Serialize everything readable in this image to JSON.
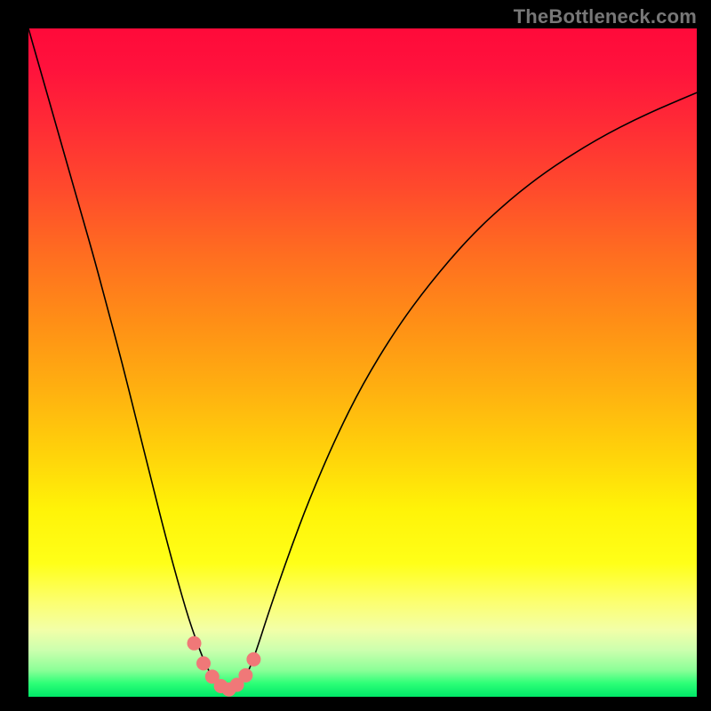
{
  "brand": {
    "watermark": "TheBottleneck.com"
  },
  "palette": {
    "frame": "#000000",
    "gradient_top": "#ff0a3a",
    "gradient_bottom": "#00e768",
    "curve": "#000000",
    "dot": "#f07878",
    "watermark": "#777777"
  },
  "chart_data": {
    "type": "line",
    "title": "",
    "xlabel": "",
    "ylabel": "",
    "xlim": [
      0,
      100
    ],
    "ylim": [
      0,
      100
    ],
    "grid": false,
    "legend": false,
    "annotations": [],
    "x": [
      0,
      2,
      4,
      6,
      8,
      10,
      12,
      14,
      16,
      18,
      20,
      22,
      24,
      26,
      27,
      28,
      29,
      30,
      31,
      32,
      33,
      34,
      36,
      39,
      42,
      46,
      50,
      55,
      60,
      66,
      72,
      78,
      85,
      92,
      100
    ],
    "values": [
      100,
      93.0,
      86.0,
      79.0,
      72.0,
      65.0,
      57.5,
      50.0,
      42.0,
      34.0,
      26.0,
      18.5,
      11.5,
      6.0,
      3.8,
      2.4,
      1.4,
      1.0,
      1.2,
      2.2,
      4.0,
      6.6,
      12.8,
      21.5,
      29.5,
      38.8,
      46.8,
      55.0,
      61.8,
      68.8,
      74.4,
      79.0,
      83.4,
      87.0,
      90.4
    ],
    "markers": {
      "x": [
        24.8,
        26.2,
        27.5,
        28.8,
        30.0,
        31.2,
        32.5,
        33.7
      ],
      "values": [
        8.0,
        5.0,
        3.0,
        1.6,
        1.1,
        1.8,
        3.2,
        5.6
      ]
    }
  }
}
